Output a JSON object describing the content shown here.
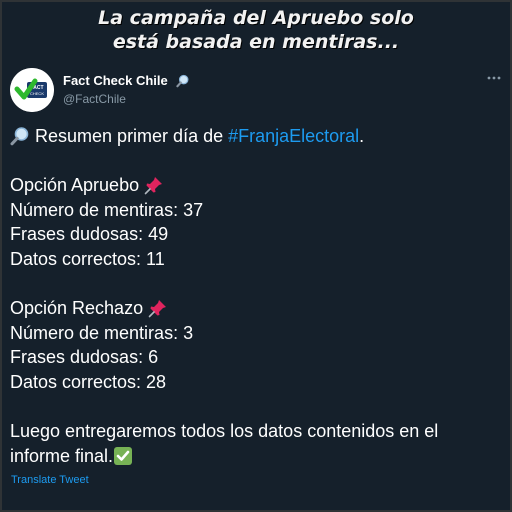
{
  "caption": {
    "line1": "La campaña del Apruebo solo",
    "line2": "está basada en mentiras..."
  },
  "account": {
    "display_name": "Fact Check Chile",
    "handle": "@FactChile",
    "avatar_text_1": "FACT",
    "avatar_text_2": "CHECK"
  },
  "tweet": {
    "intro_prefix": "Resumen primer día de ",
    "hashtag": "#FranjaElectoral",
    "intro_suffix": ".",
    "apruebo": {
      "title": "Opción Apruebo",
      "mentiras": "Número de mentiras: 37",
      "dudosas": "Frases dudosas: 49",
      "correctos": "Datos correctos: 11"
    },
    "rechazo": {
      "title": "Opción Rechazo",
      "mentiras": "Número de mentiras: 3",
      "dudosas": "Frases dudosas: 6",
      "correctos": "Datos correctos: 28"
    },
    "closing_line1": "Luego entregaremos todos los datos contenidos en el",
    "closing_line2": "informe final."
  },
  "translate_label": "Translate Tweet",
  "icons": {
    "intro": "magnifying-glass-icon",
    "name": "magnifying-glass-icon",
    "pin": "pushpin-icon",
    "check": "check-mark-button-icon",
    "more": "more-options-icon"
  },
  "colors": {
    "background": "#15202b",
    "link": "#1d9bf0",
    "secondary_text": "#8899a6"
  }
}
